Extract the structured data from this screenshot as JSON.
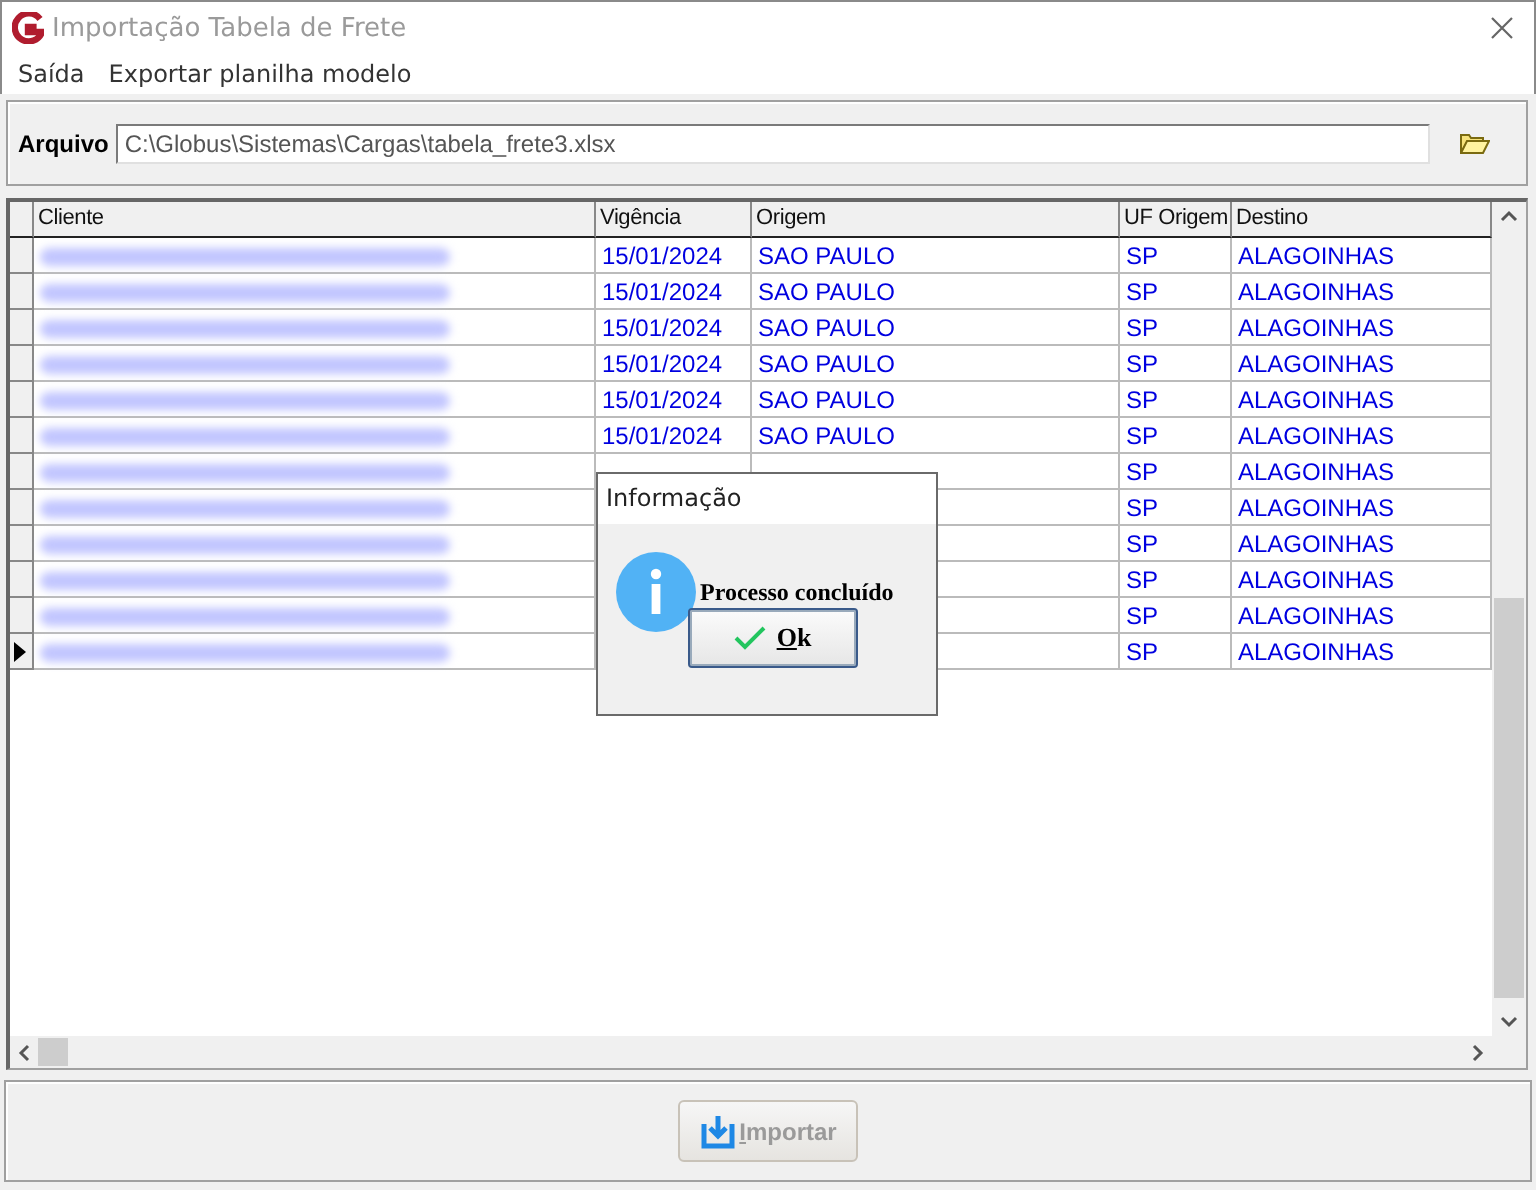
{
  "window": {
    "title": "Importação Tabela de Frete"
  },
  "menu": [
    {
      "label": "Saída"
    },
    {
      "label": "Exportar planilha modelo"
    }
  ],
  "file": {
    "label": "Arquivo",
    "value": "C:\\Globus\\Sistemas\\Cargas\\tabela_frete3.xlsx"
  },
  "table": {
    "columns": [
      "Cliente",
      "Vigência",
      "Origem",
      "UF Origem",
      "Destino"
    ],
    "rows": [
      {
        "selected": false,
        "vigencia": "15/01/2024",
        "origem": "SAO PAULO",
        "uf_origem": "SP",
        "destino": "ALAGOINHAS"
      },
      {
        "selected": false,
        "vigencia": "15/01/2024",
        "origem": "SAO PAULO",
        "uf_origem": "SP",
        "destino": "ALAGOINHAS"
      },
      {
        "selected": false,
        "vigencia": "15/01/2024",
        "origem": "SAO PAULO",
        "uf_origem": "SP",
        "destino": "ALAGOINHAS"
      },
      {
        "selected": false,
        "vigencia": "15/01/2024",
        "origem": "SAO PAULO",
        "uf_origem": "SP",
        "destino": "ALAGOINHAS"
      },
      {
        "selected": false,
        "vigencia": "15/01/2024",
        "origem": "SAO PAULO",
        "uf_origem": "SP",
        "destino": "ALAGOINHAS"
      },
      {
        "selected": false,
        "vigencia": "15/01/2024",
        "origem": "SAO PAULO",
        "uf_origem": "SP",
        "destino": "ALAGOINHAS"
      },
      {
        "selected": false,
        "uf_origem": "SP",
        "destino": "ALAGOINHAS"
      },
      {
        "selected": false,
        "uf_origem": "SP",
        "destino": "ALAGOINHAS"
      },
      {
        "selected": false,
        "uf_origem": "SP",
        "destino": "ALAGOINHAS"
      },
      {
        "selected": false,
        "uf_origem": "SP",
        "destino": "ALAGOINHAS"
      },
      {
        "selected": false,
        "uf_origem": "SP",
        "destino": "ALAGOINHAS"
      },
      {
        "selected": true,
        "uf_origem": "SP",
        "destino": "ALAGOINHAS"
      }
    ]
  },
  "dialog": {
    "title": "Informação",
    "message": "Processo concluído",
    "button": "Ok"
  },
  "import_button": {
    "label": "Importar",
    "disabled": true
  }
}
